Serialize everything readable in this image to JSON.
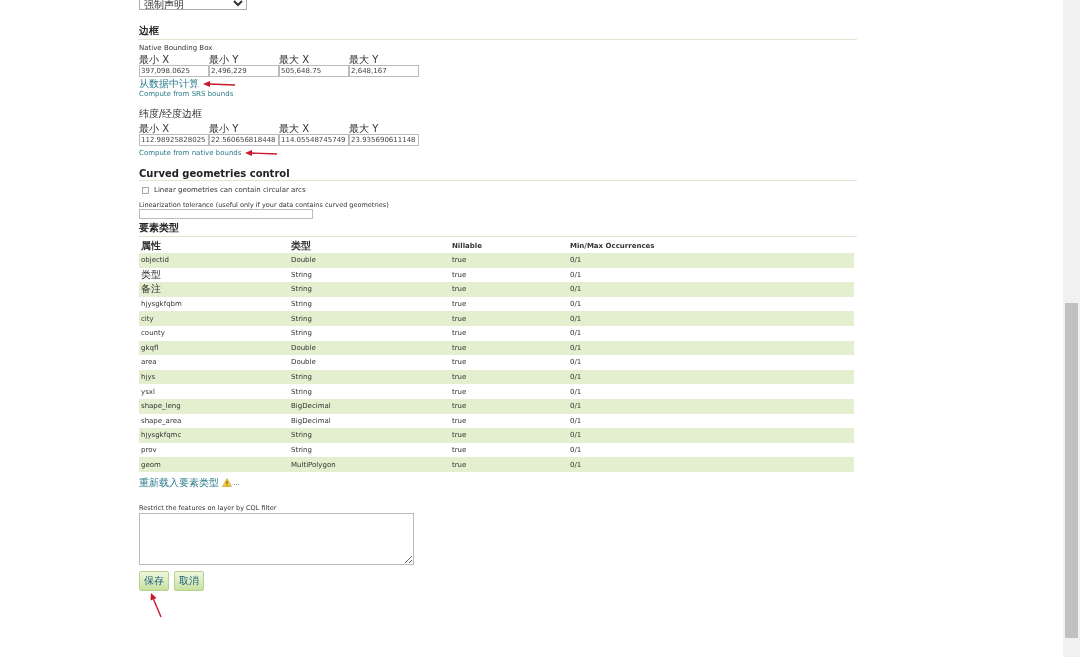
{
  "srs_handling": {
    "value": "强制声明"
  },
  "bounding_boxes": {
    "heading": "边框",
    "native": {
      "title": "Native Bounding Box",
      "fields": [
        {
          "label": "最小 X",
          "value": "397,098.0625"
        },
        {
          "label": "最小 Y",
          "value": "2,496,229"
        },
        {
          "label": "最大 X",
          "value": "505,648.75"
        },
        {
          "label": "最大 Y",
          "value": "2,648,167"
        }
      ],
      "links": [
        "从数据中计算",
        "Compute from SRS bounds"
      ]
    },
    "latlon": {
      "title": "纬度/经度边框",
      "fields": [
        {
          "label": "最小 X",
          "value": "112.98925828025"
        },
        {
          "label": "最小 Y",
          "value": "22.560656818448"
        },
        {
          "label": "最大 X",
          "value": "114.05548745749"
        },
        {
          "label": "最大 Y",
          "value": "23.935690611148"
        }
      ],
      "links": [
        "Compute from native bounds"
      ]
    }
  },
  "curved": {
    "heading": "Curved geometries control",
    "checkbox": {
      "label": "Linear geometries can contain circular arcs",
      "checked": false
    },
    "tolerance": {
      "label": "Linearization tolerance (useful only if your data contains curved geometries)"
    }
  },
  "feature_type": {
    "heading": "要素类型",
    "columns": [
      "属性",
      "类型",
      "Nillable",
      "Min/Max Occurrences"
    ],
    "rows": [
      [
        "objectid",
        "Double",
        "true",
        "0/1"
      ],
      [
        "类型",
        "String",
        "true",
        "0/1"
      ],
      [
        "备注",
        "String",
        "true",
        "0/1"
      ],
      [
        "hjysgkfqbm",
        "String",
        "true",
        "0/1"
      ],
      [
        "city",
        "String",
        "true",
        "0/1"
      ],
      [
        "county",
        "String",
        "true",
        "0/1"
      ],
      [
        "gkqfl",
        "Double",
        "true",
        "0/1"
      ],
      [
        "area",
        "Double",
        "true",
        "0/1"
      ],
      [
        "hjys",
        "String",
        "true",
        "0/1"
      ],
      [
        "ysxl",
        "String",
        "true",
        "0/1"
      ],
      [
        "shape_leng",
        "BigDecimal",
        "true",
        "0/1"
      ],
      [
        "shape_area",
        "BigDecimal",
        "true",
        "0/1"
      ],
      [
        "hjysgkfqmc",
        "String",
        "true",
        "0/1"
      ],
      [
        "prov",
        "String",
        "true",
        "0/1"
      ],
      [
        "geom",
        "MultiPolygon",
        "true",
        "0/1"
      ]
    ],
    "reload_link": "重新载入要素类型",
    "reload_suffix": "..."
  },
  "cql_filter": {
    "label": "Restrict the features on layer by CQL filter"
  },
  "buttons": [
    {
      "label": "保存"
    },
    {
      "label": "取消"
    }
  ]
}
